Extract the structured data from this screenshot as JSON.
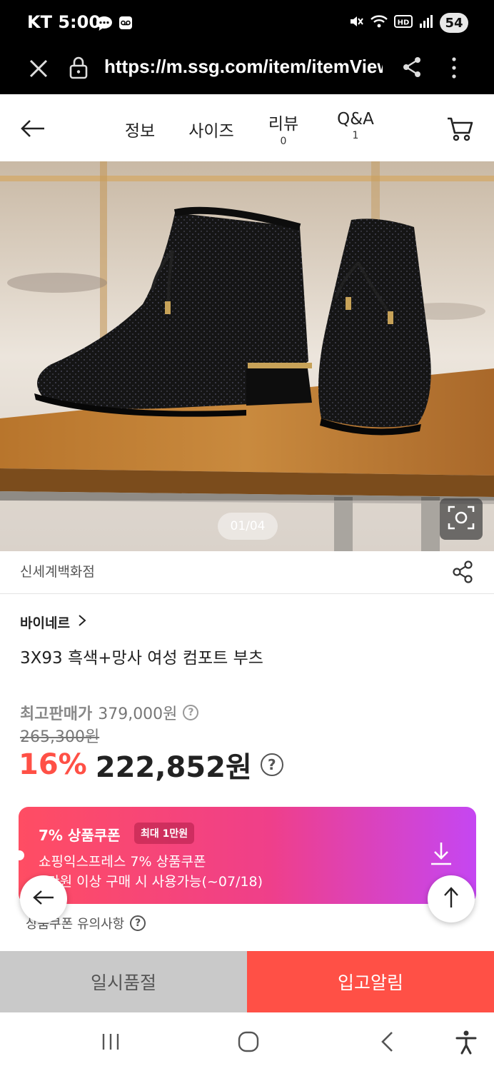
{
  "status_bar": {
    "carrier": "KT",
    "time": "5:00",
    "battery": "54"
  },
  "browser": {
    "url": "https://m.ssg.com/item/itemView"
  },
  "nav": {
    "tabs": [
      {
        "label": "정보",
        "count": ""
      },
      {
        "label": "사이즈",
        "count": ""
      },
      {
        "label": "리뷰",
        "count": "0"
      },
      {
        "label": "Q&A",
        "count": "1"
      }
    ]
  },
  "gallery": {
    "pager": "01/04"
  },
  "product": {
    "store": "신세계백화점",
    "brand": "바이네르",
    "brand_chevron": ">",
    "title": "3X93 흑색+망사 여성 컴포트 부츠",
    "max_price_label": "최고판매가",
    "max_price": "379,000원",
    "original_price": "265,300원",
    "discount_pct": "16%",
    "sale_price": "222,852원"
  },
  "coupon": {
    "title": "7% 상품쿠폰",
    "badge": "최대 1만원",
    "line1": "쇼핑익스프레스 7% 상품쿠폰",
    "line2": "1만원 이상 구매 시 사용가능(~07/18)",
    "note": "상품쿠폰 유의사항"
  },
  "actions": {
    "soldout": "일시품절",
    "restock_alert": "입고알림"
  },
  "colors": {
    "accent": "#ff5046",
    "coupon_start": "#ff4d63",
    "coupon_end": "#c546f2"
  }
}
